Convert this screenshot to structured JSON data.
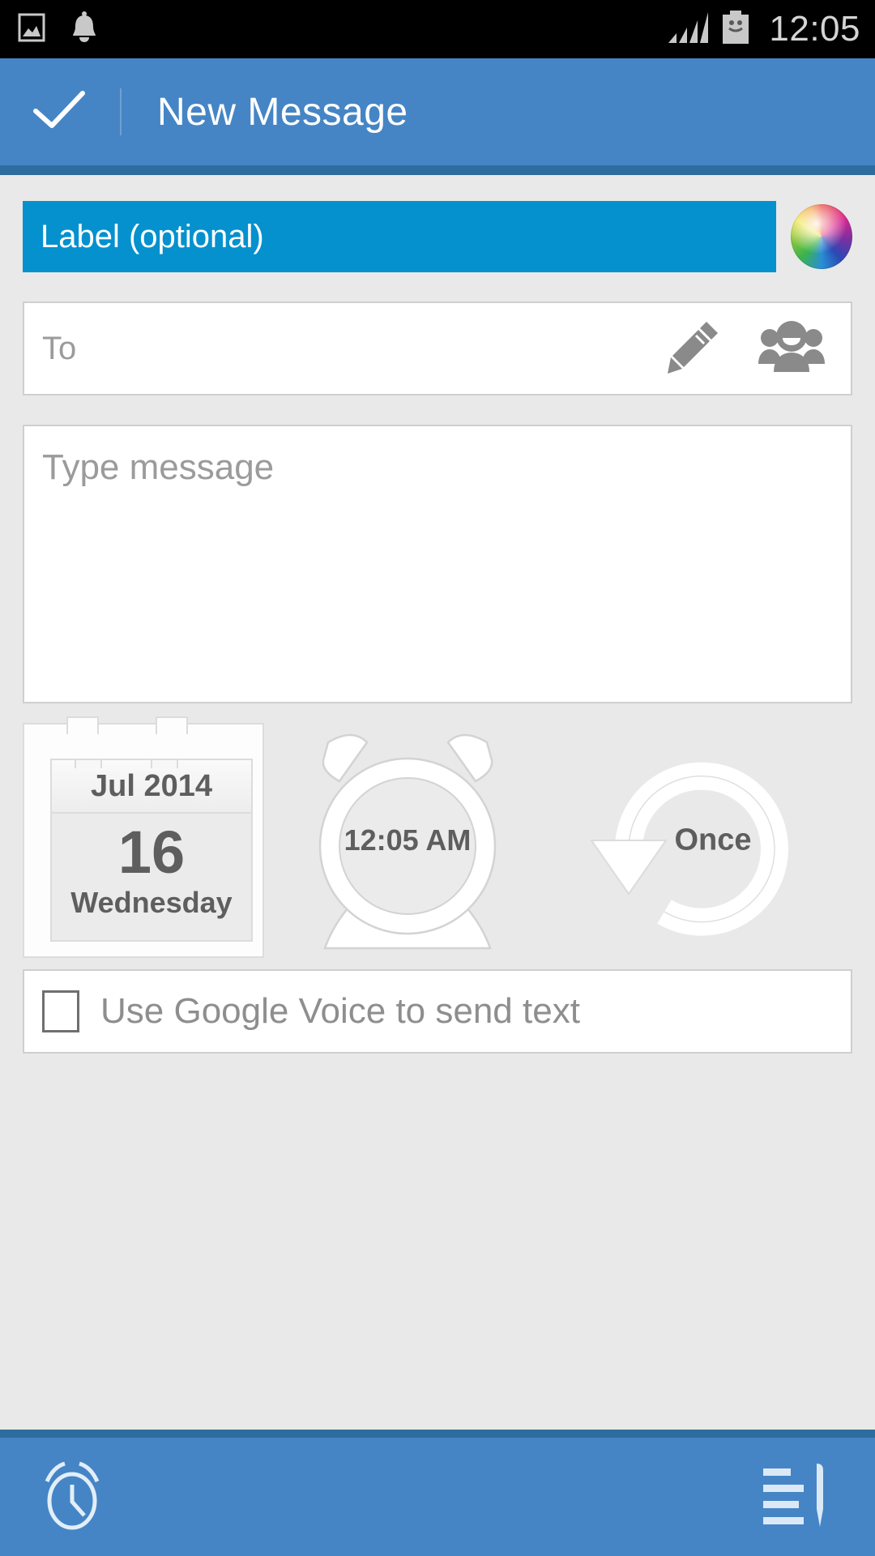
{
  "status_bar": {
    "icons": [
      "image-icon",
      "bell-icon",
      "signal-icon",
      "battery-icon"
    ],
    "clock": "12:05",
    "background": "#000000",
    "icon_color": "#c8c8c8"
  },
  "app_bar": {
    "confirm_icon": "check-icon",
    "title": "New Message",
    "background": "#4585c5",
    "underline_color": "#2c6d9e"
  },
  "form": {
    "label_field": {
      "placeholder": "Label (optional)",
      "value": "",
      "background": "#0591ce",
      "text_color": "#ffffff"
    },
    "color_picker": {
      "icon": "color-wheel-icon"
    },
    "to_field": {
      "placeholder": "To",
      "value": "",
      "edit_icon": "pencil-icon",
      "contacts_icon": "contacts-group-icon"
    },
    "message_field": {
      "placeholder": "Type message",
      "value": ""
    }
  },
  "schedule": {
    "date_widget": {
      "icon": "calendar-icon",
      "month_year": "Jul 2014",
      "day_number": "16",
      "day_of_week": "Wednesday"
    },
    "time_widget": {
      "icon": "alarm-clock-icon",
      "time": "12:05 AM"
    },
    "repeat_widget": {
      "icon": "repeat-circular-arrow-icon",
      "value": "Once"
    }
  },
  "options": {
    "google_voice": {
      "label": "Use Google Voice to send text",
      "checked": false
    }
  },
  "bottom_bar": {
    "alarm_icon": "alarm-clock-icon",
    "drafts_icon": "compose-list-icon",
    "background": "#4585c5"
  },
  "colors": {
    "page_background": "#e9e9e9",
    "accent_blue": "#4585c5",
    "label_blue": "#0591ce",
    "field_border": "#cfcfcf",
    "placeholder_grey": "#9b9b9b",
    "widget_text_grey": "#5e5e5e"
  }
}
